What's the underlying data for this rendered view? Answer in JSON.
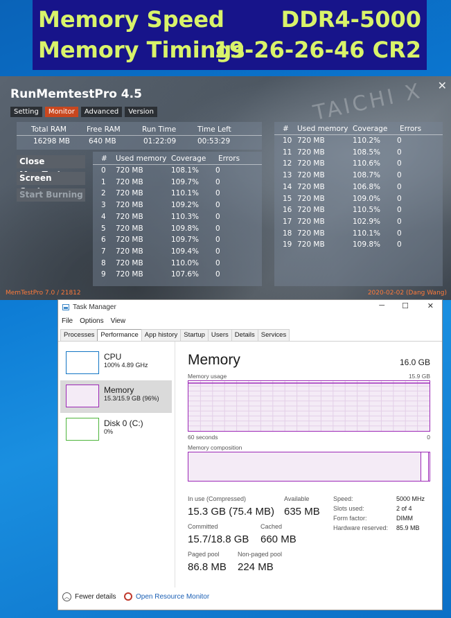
{
  "banner": {
    "row1_label": "Memory Speed",
    "row1_value": "DDR4-5000",
    "row2_label": "Memory Timings",
    "row2_value": "19-26-26-46 CR2"
  },
  "memtest": {
    "title": "RunMemtestPro 4.5",
    "tabs": [
      "Setting",
      "Monitor",
      "Advanced",
      "Version"
    ],
    "active_tab": "Monitor",
    "stats_headers": [
      "Total RAM",
      "Free RAM",
      "Run Time",
      "Time Left"
    ],
    "stats_values": [
      "16298 MB",
      "640 MB",
      "01:22:09",
      "00:53:29"
    ],
    "buttons": [
      "Close MemTest",
      "Screen Capture",
      "Start Burning"
    ],
    "table_headers": [
      "#",
      "Used memory",
      "Coverage",
      "Errors"
    ],
    "rows_left": [
      [
        "0",
        "720 MB",
        "108.1%",
        "0"
      ],
      [
        "1",
        "720 MB",
        "109.7%",
        "0"
      ],
      [
        "2",
        "720 MB",
        "110.1%",
        "0"
      ],
      [
        "3",
        "720 MB",
        "109.2%",
        "0"
      ],
      [
        "4",
        "720 MB",
        "110.3%",
        "0"
      ],
      [
        "5",
        "720 MB",
        "109.8%",
        "0"
      ],
      [
        "6",
        "720 MB",
        "109.7%",
        "0"
      ],
      [
        "7",
        "720 MB",
        "109.4%",
        "0"
      ],
      [
        "8",
        "720 MB",
        "110.0%",
        "0"
      ],
      [
        "9",
        "720 MB",
        "107.6%",
        "0"
      ]
    ],
    "rows_right": [
      [
        "10",
        "720 MB",
        "110.2%",
        "0"
      ],
      [
        "11",
        "720 MB",
        "108.5%",
        "0"
      ],
      [
        "12",
        "720 MB",
        "110.6%",
        "0"
      ],
      [
        "13",
        "720 MB",
        "108.7%",
        "0"
      ],
      [
        "14",
        "720 MB",
        "106.8%",
        "0"
      ],
      [
        "15",
        "720 MB",
        "109.0%",
        "0"
      ],
      [
        "16",
        "720 MB",
        "110.5%",
        "0"
      ],
      [
        "17",
        "720 MB",
        "102.9%",
        "0"
      ],
      [
        "18",
        "720 MB",
        "110.1%",
        "0"
      ],
      [
        "19",
        "720 MB",
        "109.8%",
        "0"
      ]
    ],
    "footer_left": "MemTestPro 7.0 / 21812",
    "footer_right": "2020-02-02 (Dang Wang)",
    "accent_color": "#c9471f"
  },
  "taskmanager": {
    "title": "Task Manager",
    "menu": [
      "File",
      "Options",
      "View"
    ],
    "tabs": [
      "Processes",
      "Performance",
      "App history",
      "Startup",
      "Users",
      "Details",
      "Services"
    ],
    "active_tab": "Performance",
    "sidebar": [
      {
        "name": "CPU",
        "sub": "100%  4.89 GHz",
        "color": "#1174c4"
      },
      {
        "name": "Memory",
        "sub": "15.3/15.9 GB (96%)",
        "color": "#9b26b6"
      },
      {
        "name": "Disk 0 (C:)",
        "sub": "0%",
        "color": "#4db43a"
      }
    ],
    "heading": "Memory",
    "total": "16.0 GB",
    "usage_label": "Memory usage",
    "usage_max": "15.9 GB",
    "axis_left": "60 seconds",
    "axis_right": "0",
    "composition_label": "Memory composition",
    "stats": {
      "in_use_label": "In use (Compressed)",
      "in_use": "15.3 GB (75.4 MB)",
      "available_label": "Available",
      "available": "635 MB",
      "committed_label": "Committed",
      "committed": "15.7/18.8 GB",
      "cached_label": "Cached",
      "cached": "660 MB",
      "paged_label": "Paged pool",
      "paged": "86.8 MB",
      "nonpaged_label": "Non-paged pool",
      "nonpaged": "224 MB"
    },
    "right_stats": [
      {
        "label": "Speed:",
        "value": "5000 MHz"
      },
      {
        "label": "Slots used:",
        "value": "2 of 4"
      },
      {
        "label": "Form factor:",
        "value": "DIMM"
      },
      {
        "label": "Hardware reserved:",
        "value": "85.9 MB"
      }
    ],
    "fewer_details": "Fewer details",
    "open_resource_monitor": "Open Resource Monitor",
    "usage_fraction": 0.96,
    "accent_color": "#9b26b6"
  }
}
